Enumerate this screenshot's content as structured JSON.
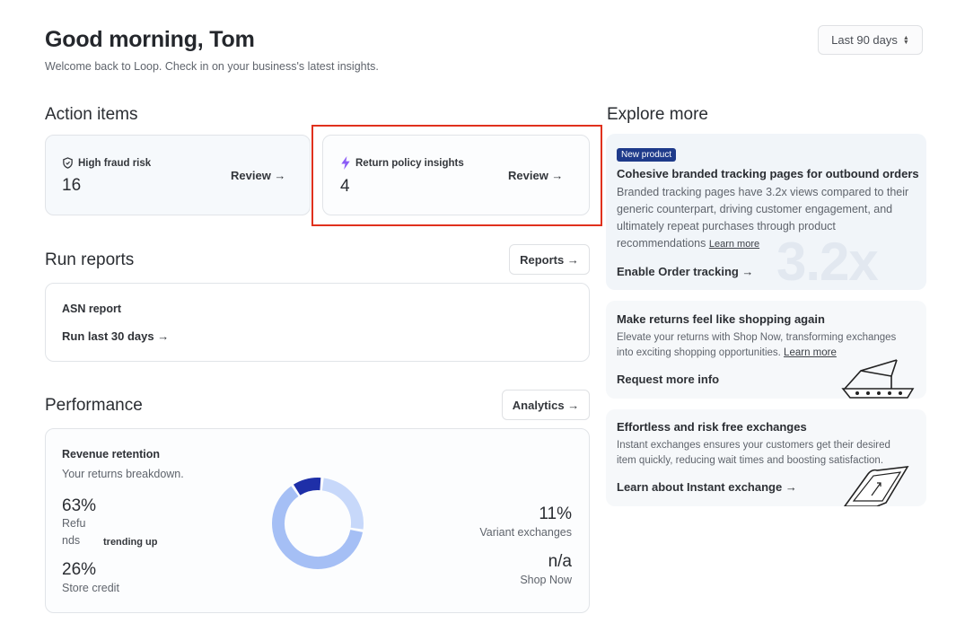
{
  "header": {
    "greeting": "Good morning, Tom",
    "subtitle": "Welcome back to Loop. Check in on your business's latest insights.",
    "date_range": "Last 90 days"
  },
  "action_items": {
    "title": "Action items",
    "cards": [
      {
        "label": "High fraud risk",
        "count": "16",
        "action": "Review →",
        "icon": "shield-icon"
      },
      {
        "label": "Return policy insights",
        "count": "4",
        "action": "Review →",
        "icon": "lightning-icon"
      }
    ]
  },
  "run_reports": {
    "title": "Run reports",
    "button": "Reports →",
    "report_name": "ASN report",
    "report_action": "Run last 30 days →"
  },
  "performance": {
    "title": "Performance",
    "button": "Analytics →",
    "card_title": "Revenue retention",
    "card_subtitle": "Your returns breakdown.",
    "refunds_pct": "63%",
    "refunds_label_1": "Refu",
    "refunds_label_2": "nds",
    "trend": "trending up",
    "store_credit_pct": "26%",
    "store_credit_label": "Store credit",
    "variant_pct": "11%",
    "variant_label": "Variant exchanges",
    "shop_now_value": "n/a",
    "shop_now_label": "Shop Now"
  },
  "chart_data": {
    "type": "pie",
    "categories": [
      "Refunds",
      "Store credit",
      "Variant exchanges"
    ],
    "values": [
      63,
      26,
      11
    ],
    "colors": [
      "#a5bff5",
      "#c7d8fa",
      "#1e2fa8"
    ]
  },
  "explore": {
    "title": "Explore more",
    "cards": [
      {
        "badge": "New product",
        "title": "Cohesive branded tracking pages for outbound orders",
        "body": "Branded tracking pages have 3.2x views compared to their generic counterpart, driving customer engagement, and ultimately repeat purchases through product recommendations",
        "learn_more": "Learn more",
        "cta": "Enable Order tracking →",
        "watermark": "3.2x"
      },
      {
        "title": "Make returns feel like shopping again",
        "body": "Elevate your returns with Shop Now, transforming exchanges into exciting shopping opportunities.",
        "learn_more": "Learn more",
        "cta": "Request more info"
      },
      {
        "title": "Effortless and risk free exchanges",
        "body": "Instant exchanges ensures your customers get their desired item quickly, reducing wait times and boosting satisfaction.",
        "cta": "Learn about Instant exchange →"
      }
    ]
  }
}
